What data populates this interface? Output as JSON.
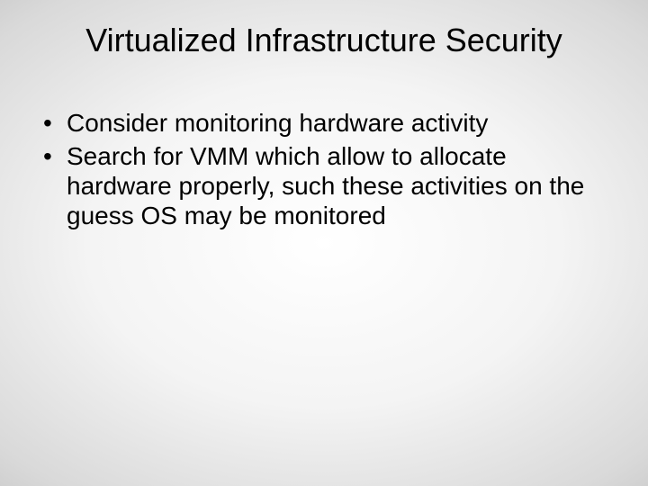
{
  "slide": {
    "title": "Virtualized Infrastructure Security",
    "bullets": [
      "Consider monitoring hardware activity",
      "Search for VMM which allow to allocate hardware properly, such these activities on the guess OS may be monitored"
    ]
  }
}
